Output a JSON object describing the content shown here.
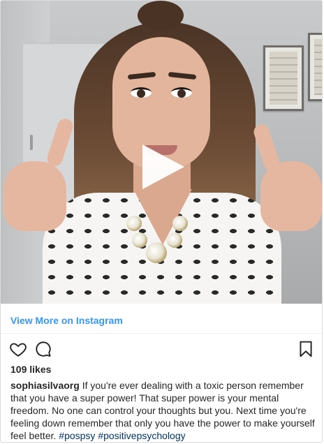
{
  "post": {
    "view_more_label": "View More on Instagram",
    "likes": "109 likes",
    "username": "sophiasilvaorg",
    "caption": "If you're ever dealing with a toxic person remember that you have a super power! That super power is your mental freedom. No one can control your thoughts but you. Next time you're feeling down remember that only you have the power to make yourself feel better. ",
    "hashtags": [
      "#pospsy",
      "#positivepsychology"
    ]
  },
  "icons": {
    "play": "play-icon",
    "like": "heart-icon",
    "comment": "comment-icon",
    "save": "bookmark-icon"
  },
  "colors": {
    "link": "#3897f0",
    "text": "#262626",
    "hashtag": "#003569"
  }
}
